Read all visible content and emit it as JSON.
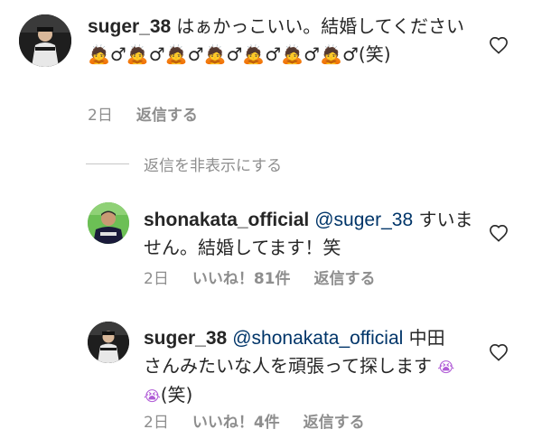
{
  "comments": [
    {
      "username": "suger_38",
      "text_1": "はぁかっこいい。結婚してください",
      "text_2": "(笑)",
      "emoji_bow": "🙇",
      "emoji_male": "♂",
      "time": "2日",
      "likes": "",
      "reply": "返信する"
    },
    {
      "username": "shonakata_official",
      "mention": "@suger_38",
      "text_1": "すいません。結婚してます！笑",
      "time": "2日",
      "likes": "いいね！81件",
      "reply": "返信する"
    },
    {
      "username": "suger_38",
      "mention": "@shonakata_official",
      "text_1": "中田さんみたいな人を頑張って探します",
      "text_2": "(笑)",
      "emoji_tear": "😭",
      "time": "2日",
      "likes": "いいね！4件",
      "reply": "返信する"
    }
  ],
  "hide_replies": "返信を非表示にする",
  "colors": {
    "text": "#262626",
    "muted": "#8e8e8e",
    "mention": "#003569",
    "bow_emoji": "#f5a623",
    "tear_emoji": "#b05bd6"
  },
  "icons": [
    "heart-icon",
    "avatar-icon"
  ]
}
